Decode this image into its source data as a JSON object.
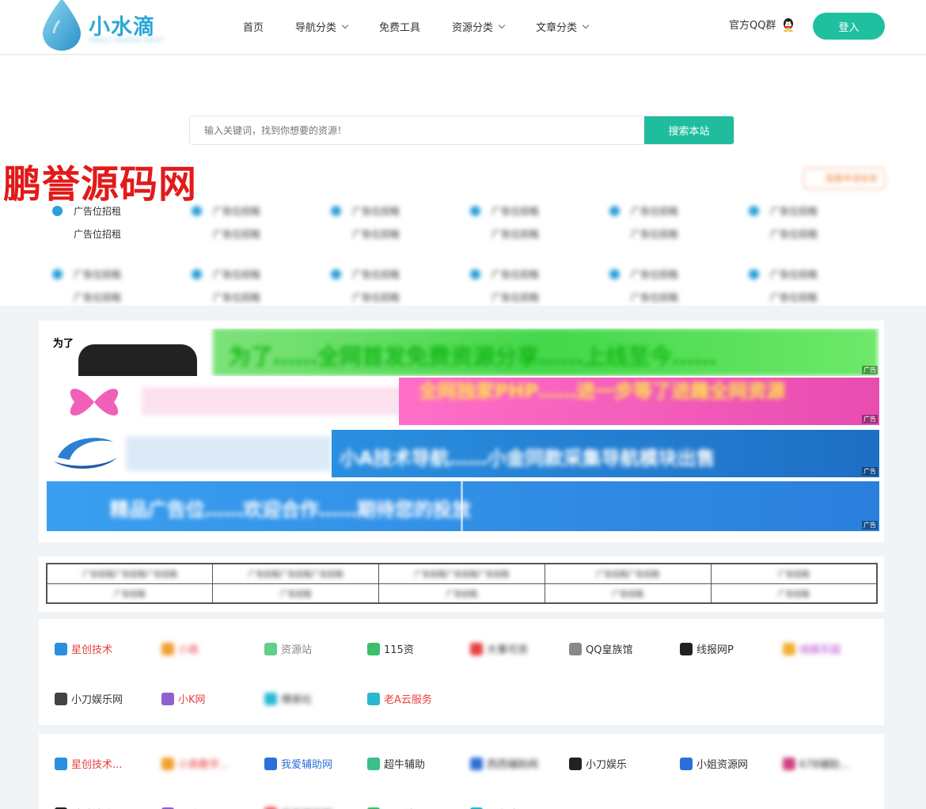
{
  "header": {
    "logo_text": "小水滴",
    "logo_sub": "SMALL WATER DROP",
    "nav": [
      {
        "label": "首页",
        "has_dropdown": false
      },
      {
        "label": "导航分类",
        "has_dropdown": true
      },
      {
        "label": "免费工具",
        "has_dropdown": false
      },
      {
        "label": "资源分类",
        "has_dropdown": true
      },
      {
        "label": "文章分类",
        "has_dropdown": true
      }
    ],
    "qq_group": "官方QQ群",
    "login": "登入"
  },
  "search": {
    "placeholder": "输入关键词，找到你想要的资源！",
    "button": "搜索本站"
  },
  "watermark": "鹏誉源码网",
  "ad_section": {
    "apply_label": "我要申请收录",
    "cells": [
      {
        "line1": "广告位招租",
        "line2": "广告位招租"
      },
      {
        "line1": "广告位招租",
        "line2": "广告位招租"
      },
      {
        "line1": "广告位招租",
        "line2": "广告位招租"
      },
      {
        "line1": "广告位招租",
        "line2": "广告位招租"
      },
      {
        "line1": "广告位招租",
        "line2": "广告位招租"
      },
      {
        "line1": "广告位招租",
        "line2": "广告位招租"
      },
      {
        "line1": "广告位招租",
        "line2": "广告位招租"
      },
      {
        "line1": "广告位招租",
        "line2": "广告位招租"
      },
      {
        "line1": "广告位招租",
        "line2": "广告位招租"
      },
      {
        "line1": "广告位招租",
        "line2": "广告位招租"
      },
      {
        "line1": "广告位招租",
        "line2": "广告位招租"
      },
      {
        "line1": "广告位招租",
        "line2": "广告位招租"
      }
    ]
  },
  "banners": [
    {
      "text": "为了……全网首发免费资源分享……上线至今……",
      "tag": "广告",
      "bg": "#5ae05a"
    },
    {
      "text": "全网独家PHP……进一步等了进趣全网资源",
      "tag": "广告",
      "bg": "#f05fb0"
    },
    {
      "text": "小A技术导航……小金同款采集导航模块出售",
      "tag": "广告",
      "bg": "#2a7fd4"
    },
    {
      "text": "精品广告位……欢迎合作……期待您的投放",
      "tag": "广告",
      "bg": "#3b8eea"
    }
  ],
  "link_table": [
    [
      "广告招租广告招租广告招租",
      "广告招租广告招租广告招租",
      "广告招租广告招租广告招租",
      "广告招租广告招租",
      "广告招租"
    ],
    [
      "广告招租",
      "广告招租",
      "广告招租",
      "广告招租",
      "广告招租"
    ]
  ],
  "friend_links_1": [
    {
      "label": "星创技术",
      "color": "#e84040",
      "icon": "#2a8fe0"
    },
    {
      "label": "小高",
      "color": "#e84040",
      "icon": "#f0a030"
    },
    {
      "label": "资源站",
      "color": "#888",
      "icon": "#5fcf8a"
    },
    {
      "label": "115资",
      "color": "#333",
      "icon": "#3cbf6a"
    },
    {
      "label": "大事可资",
      "color": "#333",
      "icon": "#e84040"
    },
    {
      "label": "QQ皇族馆",
      "color": "#333",
      "icon": "#888"
    },
    {
      "label": "线报网P",
      "color": "#333",
      "icon": "#222"
    },
    {
      "label": "线报乐园",
      "color": "#b040d0",
      "icon": "#f0b030"
    },
    {
      "label": "小刀娱乐网",
      "color": "#333",
      "icon": "#444"
    },
    {
      "label": "小K网",
      "color": "#e84040",
      "icon": "#9060d0"
    },
    {
      "label": "傅弟社",
      "color": "#333",
      "icon": "#2ab8d0"
    },
    {
      "label": "老A云服务",
      "color": "#e84040",
      "icon": "#2ab8d0"
    }
  ],
  "friend_links_2": [
    {
      "label": "星创技术...",
      "color": "#e84040",
      "icon": "#2a8fe0"
    },
    {
      "label": "小高教学...",
      "color": "#e84040",
      "icon": "#f0a030"
    },
    {
      "label": "我爱辅助网",
      "color": "#2a70d8",
      "icon": "#2a70d8"
    },
    {
      "label": "超牛辅助",
      "color": "#333",
      "icon": "#3cbf8a"
    },
    {
      "label": "西西辅助网",
      "color": "#333",
      "icon": "#2a70d8"
    },
    {
      "label": "小刀娱乐",
      "color": "#333",
      "icon": "#222"
    },
    {
      "label": "小姐资源网",
      "color": "#333",
      "icon": "#2a70d8"
    },
    {
      "label": "678辅助...",
      "color": "#333",
      "icon": "#d04080"
    },
    {
      "label": "酷酷辅助网",
      "color": "#333",
      "icon": "#222"
    },
    {
      "label": "明诚源码",
      "color": "#333",
      "icon": "#9060d0"
    },
    {
      "label": "乐乐娱乐网",
      "color": "#333",
      "icon": "#e84040"
    },
    {
      "label": "源码站",
      "color": "#333",
      "icon": "#3cbf6a"
    },
    {
      "label": "小白站",
      "color": "#333",
      "icon": "#2ab8d0"
    }
  ]
}
